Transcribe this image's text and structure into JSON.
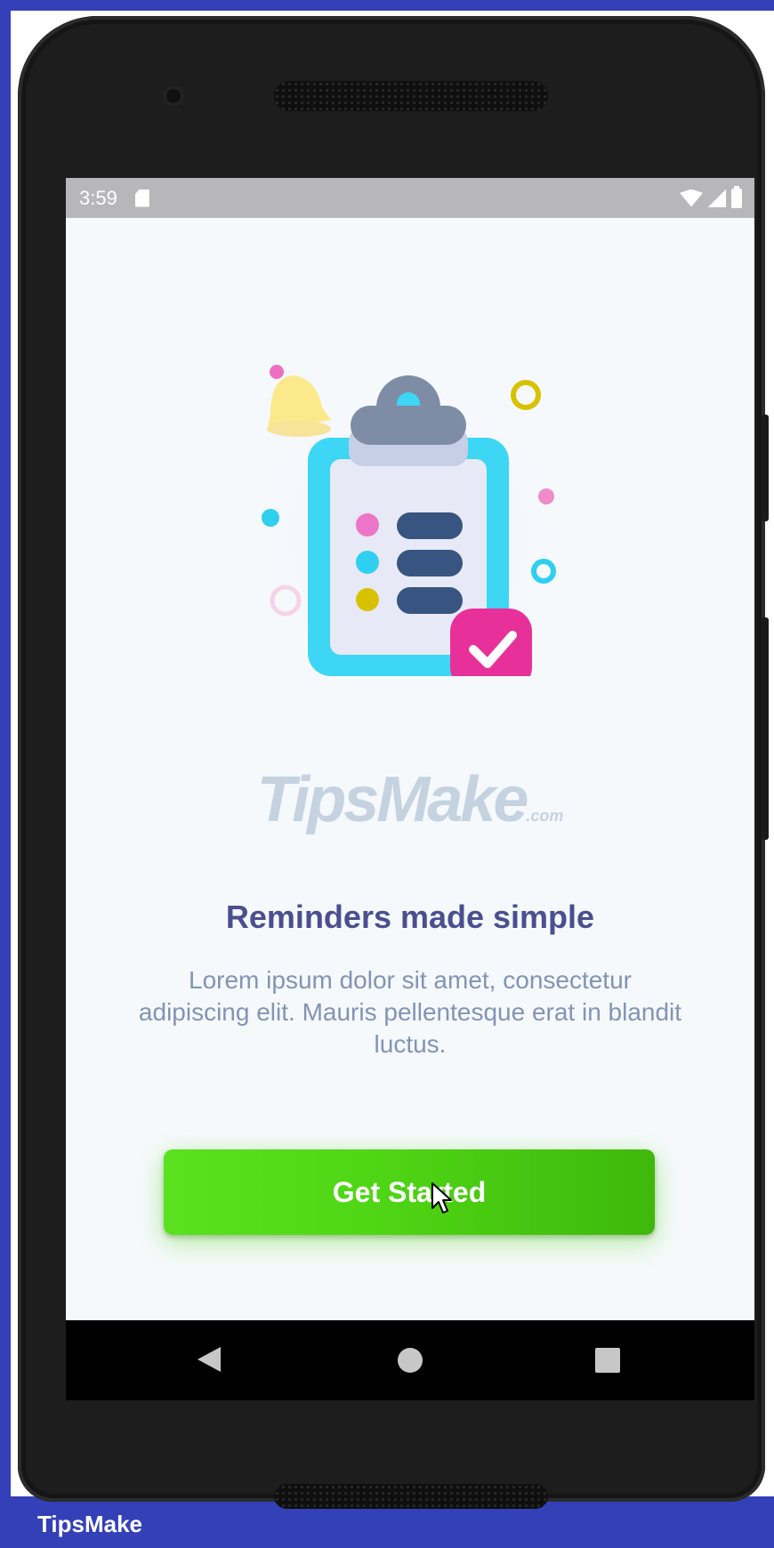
{
  "status_bar": {
    "time": "3:59",
    "icons": [
      "sd-card-icon",
      "wifi-icon",
      "signal-icon",
      "battery-icon"
    ]
  },
  "onboarding": {
    "illustration": "clipboard-checklist-illustration",
    "logo_text": "TipsMake",
    "logo_suffix": ".com",
    "title": "Reminders made simple",
    "description": "Lorem ipsum dolor sit amet, consectetur adipiscing elit. Mauris pellentesque erat in blandit luctus.",
    "cta_label": "Get Started"
  },
  "nav_bar": {
    "icons": [
      "back-icon",
      "home-icon",
      "recents-icon"
    ]
  },
  "footer": {
    "label": "TipsMake"
  },
  "colors": {
    "frame": "#3340b8",
    "screen_bg": "#f6f9fc",
    "title": "#4a4f8f",
    "description": "#8294b4",
    "button": "#4ed514",
    "clipboard": "#3dd6f5",
    "check_badge": "#e8309a"
  }
}
